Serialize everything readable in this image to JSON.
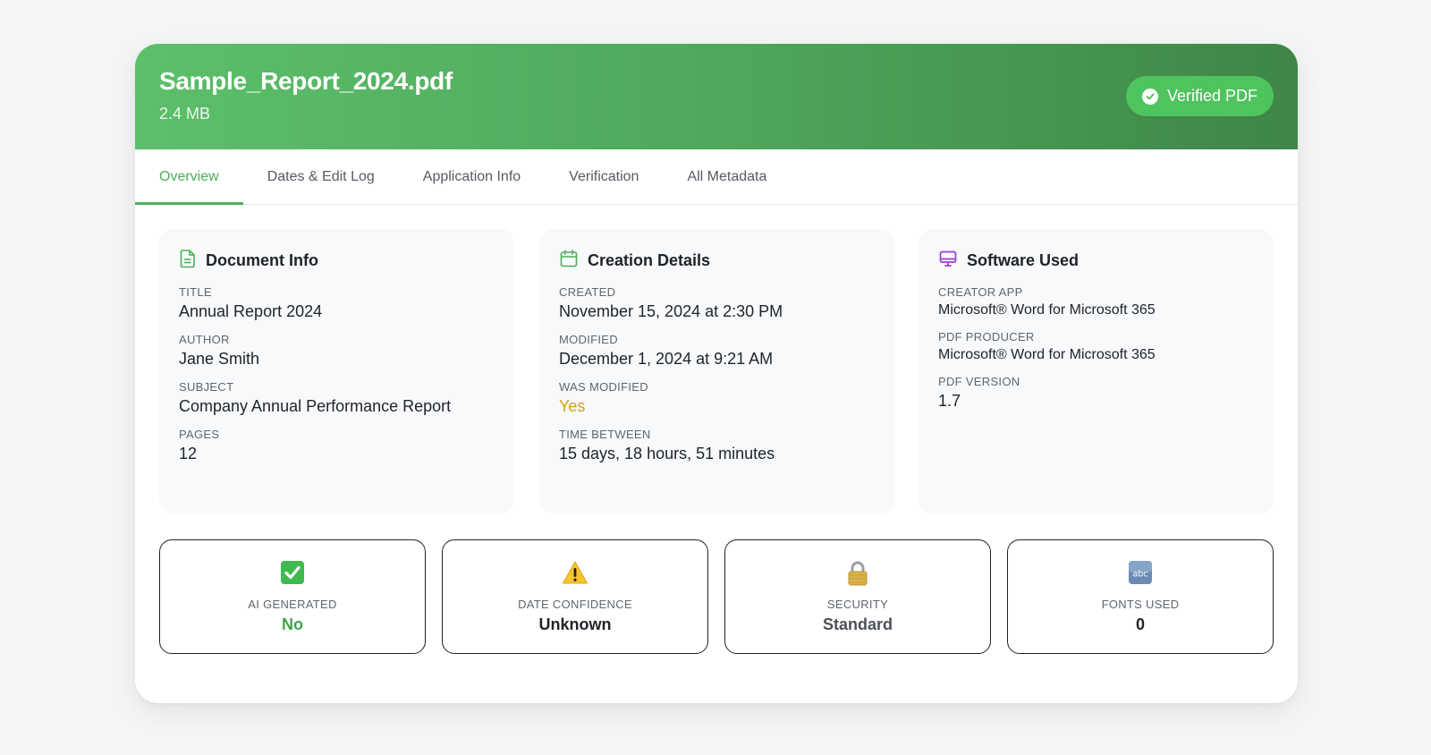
{
  "header": {
    "file_name": "Sample_Report_2024.pdf",
    "file_size": "2.4 MB",
    "badge_label": "Verified PDF"
  },
  "tabs": [
    {
      "label": "Overview",
      "active": true
    },
    {
      "label": "Dates & Edit Log",
      "active": false
    },
    {
      "label": "Application Info",
      "active": false
    },
    {
      "label": "Verification",
      "active": false
    },
    {
      "label": "All Metadata",
      "active": false
    }
  ],
  "document_info": {
    "title": "Document Info",
    "fields": [
      {
        "label": "TITLE",
        "value": "Annual Report 2024"
      },
      {
        "label": "AUTHOR",
        "value": "Jane Smith"
      },
      {
        "label": "SUBJECT",
        "value": "Company Annual Performance Report"
      },
      {
        "label": "PAGES",
        "value": "12"
      }
    ]
  },
  "creation_details": {
    "title": "Creation Details",
    "fields": [
      {
        "label": "CREATED",
        "value": "November 15, 2024 at 2:30 PM"
      },
      {
        "label": "MODIFIED",
        "value": "December 1, 2024 at 9:21 AM"
      },
      {
        "label": "WAS MODIFIED",
        "value": "Yes"
      },
      {
        "label": "TIME BETWEEN",
        "value": "15 days, 18 hours, 51 minutes"
      }
    ]
  },
  "software_used": {
    "title": "Software Used",
    "fields": [
      {
        "label": "CREATOR APP",
        "value": "Microsoft® Word for Microsoft 365"
      },
      {
        "label": "PDF PRODUCER",
        "value": "Microsoft® Word for Microsoft 365"
      },
      {
        "label": "PDF VERSION",
        "value": "1.7"
      }
    ]
  },
  "stats": [
    {
      "icon": "check-mark-icon",
      "label": "AI GENERATED",
      "value": "No"
    },
    {
      "icon": "warning-icon",
      "label": "DATE CONFIDENCE",
      "value": "Unknown"
    },
    {
      "icon": "lock-icon",
      "label": "SECURITY",
      "value": "Standard"
    },
    {
      "icon": "abc-icon",
      "label": "FONTS USED",
      "value": "0"
    }
  ],
  "colors": {
    "accent": "#4caf58",
    "header_start": "#5cbf6a",
    "header_end": "#3f8648",
    "warning": "#d4a017",
    "software_icon": "#9b3fd4"
  }
}
